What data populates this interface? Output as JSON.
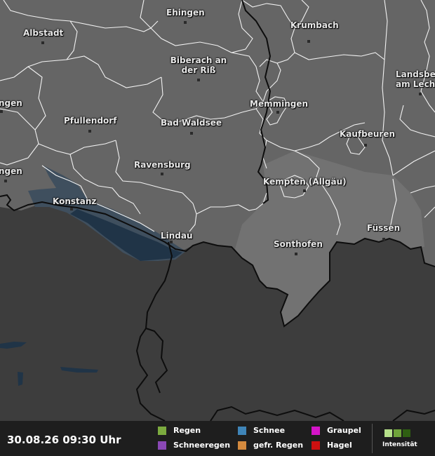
{
  "timestamp": "30.08.26 09:30 Uhr",
  "colors": {
    "outside": "#3d3d3d",
    "region": "#656565",
    "allgaeu": "#727272",
    "lake": "#3f4f5e",
    "lake_dark": "#203447",
    "border": "#111111",
    "district": "#ffffff"
  },
  "cities": [
    {
      "name": "Ehingen"
    },
    {
      "name": "Albstadt"
    },
    {
      "name": "Krumbach"
    },
    {
      "name": "Biberach an der Riß"
    },
    {
      "name": "Landsberg am Lech"
    },
    {
      "name": "ngen"
    },
    {
      "name": "Memmingen"
    },
    {
      "name": "Pfullendorf"
    },
    {
      "name": "Bad Waldsee"
    },
    {
      "name": "Kaufbeuren"
    },
    {
      "name": "ngen"
    },
    {
      "name": "Ravensburg"
    },
    {
      "name": "Kempten (Allgäu)"
    },
    {
      "name": "Konstanz"
    },
    {
      "name": "Füssen"
    },
    {
      "name": "Lindau"
    },
    {
      "name": "Sonthofen"
    }
  ],
  "legend": {
    "items": [
      {
        "label": "Regen",
        "color": "#7cab3f"
      },
      {
        "label": "Schneeregen",
        "color": "#8a48b5"
      },
      {
        "label": "Schnee",
        "color": "#3f85b8"
      },
      {
        "label": "gefr. Regen",
        "color": "#d48a3e"
      },
      {
        "label": "Graupel",
        "color": "#d414c8"
      },
      {
        "label": "Hagel",
        "color": "#cc1010"
      }
    ],
    "intensity_label": "Intensität",
    "intensity_colors": [
      "#b6e08a",
      "#6fa43a",
      "#2f5f12"
    ]
  }
}
